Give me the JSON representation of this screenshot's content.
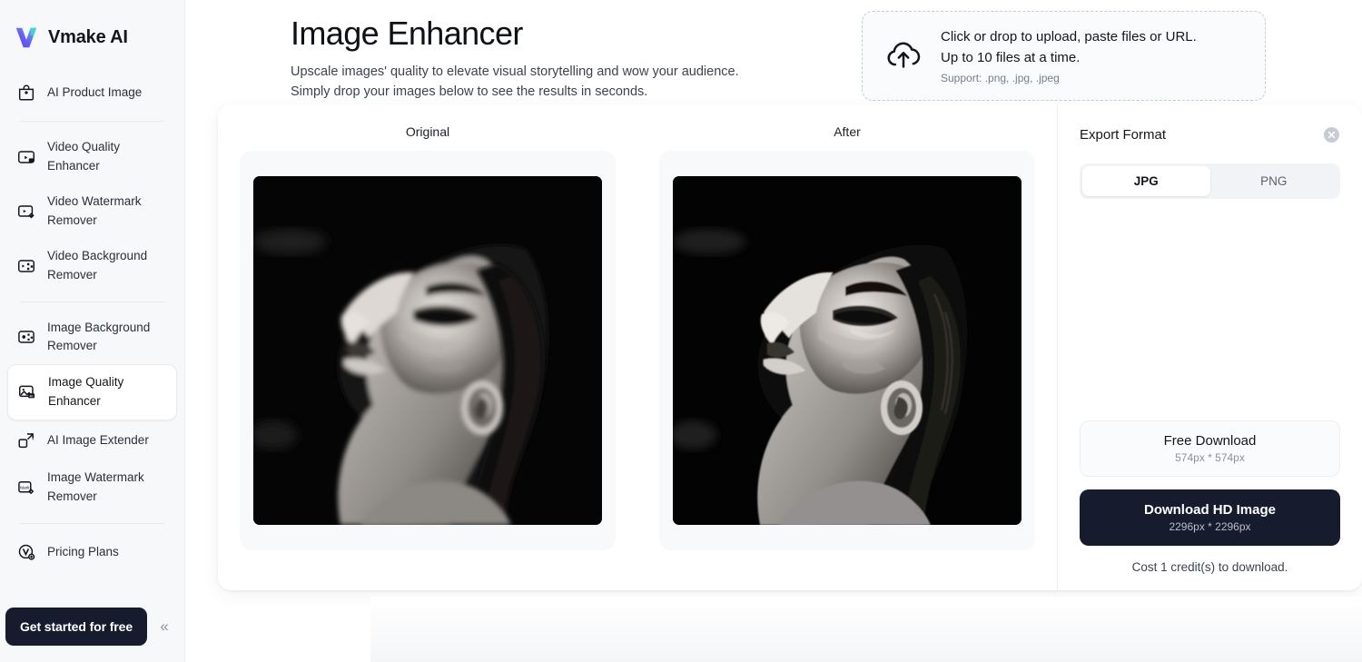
{
  "brand": {
    "name": "Vmake AI",
    "logo_icon": "vmake-v-logo"
  },
  "sidebar": {
    "items": [
      {
        "label": "AI Product Image",
        "icon": "shopping-bag-icon",
        "active": false
      },
      {
        "label": "Video Quality Enhancer",
        "icon": "video-4k-icon",
        "active": false
      },
      {
        "label": "Video Watermark Remover",
        "icon": "video-watermark-icon",
        "active": false
      },
      {
        "label": "Video Background Remover",
        "icon": "video-background-icon",
        "active": false
      },
      {
        "label": "Image Background Remover",
        "icon": "image-background-icon",
        "active": false
      },
      {
        "label": "Image Quality Enhancer",
        "icon": "image-4k-icon",
        "active": true
      },
      {
        "label": "AI Image Extender",
        "icon": "expand-arrows-icon",
        "active": false
      },
      {
        "label": "Image Watermark Remover",
        "icon": "image-watermark-icon",
        "active": false
      },
      {
        "label": "Pricing Plans",
        "icon": "pricing-badge-icon",
        "active": false
      }
    ],
    "cta_label": "Get started for free",
    "collapse_icon": "chevron-double-left-icon"
  },
  "header": {
    "title": "Image Enhancer",
    "subtitle_line1": "Upscale images' quality to elevate visual storytelling and wow your audience.",
    "subtitle_line2": "Simply drop your images below to see the results in seconds."
  },
  "upload": {
    "icon": "cloud-upload-icon",
    "line1": "Click or drop to upload, paste files or URL.",
    "line2": "Up to 10 files at a time.",
    "support": "Support: .png, .jpg, .jpeg"
  },
  "compare": {
    "original_label": "Original",
    "after_label": "After"
  },
  "export": {
    "title": "Export Format",
    "close_icon": "close-circle-icon",
    "formats": [
      {
        "label": "JPG",
        "selected": true
      },
      {
        "label": "PNG",
        "selected": false
      }
    ],
    "free_download": {
      "label": "Free Download",
      "dimensions": "574px * 574px"
    },
    "hd_download": {
      "label": "Download HD Image",
      "dimensions": "2296px * 2296px"
    },
    "cost_note": "Cost 1 credit(s) to download."
  },
  "colors": {
    "brand_dark": "#161c2d",
    "sidebar_bg": "#f7f8fa",
    "page_bg": "#ffffff",
    "text_primary": "#14161c",
    "text_muted": "#8b919c"
  }
}
